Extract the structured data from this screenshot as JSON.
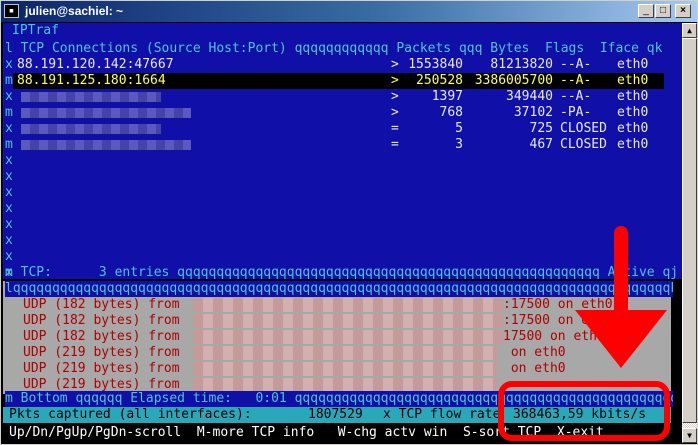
{
  "window": {
    "title": "julien@sachiel: ~",
    "buttons": [
      "_",
      "□",
      "×"
    ]
  },
  "app_name": "IPTraf",
  "tcp": {
    "header": "l TCP Connections (Source Host:Port) qqqqqqqqqqqq Packets qqq Bytes  Flags  Iface qk",
    "rows": [
      {
        "prefix": "x",
        "host": "88.191.120.142:47667",
        "dir": ">",
        "packets": "1553840",
        "bytes": "81213820",
        "flags": "--A-",
        "iface": "eth0",
        "selected": false
      },
      {
        "prefix": "m",
        "host": "88.191.125.180:1664",
        "dir": ">",
        "packets": "250528",
        "bytes": "3386005700",
        "flags": "--A-",
        "iface": "eth0",
        "selected": true
      },
      {
        "prefix": "x",
        "host": "",
        "dir": ">",
        "packets": "1397",
        "bytes": "349440",
        "flags": "--A-",
        "iface": "eth0",
        "selected": false
      },
      {
        "prefix": "m",
        "host": "",
        "dir": ">",
        "packets": "768",
        "bytes": "37102",
        "flags": "-PA-",
        "iface": "eth0",
        "selected": false
      },
      {
        "prefix": "x",
        "host": "",
        "dir": "=",
        "packets": "5",
        "bytes": "725",
        "flags": "CLOSED",
        "iface": "eth0",
        "selected": false
      },
      {
        "prefix": "m",
        "host": "",
        "dir": "=",
        "packets": "3",
        "bytes": "467",
        "flags": "CLOSED",
        "iface": "eth0",
        "selected": false
      }
    ],
    "empty_prefix": "x",
    "footer": "m TCP:      3 entries qqqqqqqqqqqqqqqqqqqqqqqqqqqqqqqqqqqqqqqqqqqqqqqqqqqqqq Active qj"
  },
  "udp": {
    "border_top": "lqqqqqqqqqqqqqqqqqqqqqqqqqqqqqqqqqqqqqqqqqqqqqqqqqqqqqqqqqqqqqqqqqqqqqqqqqqqqqqqqqqqqk",
    "rows": [
      {
        "text": "UDP (182 bytes) from",
        "tail": ":17500 on eth0"
      },
      {
        "text": "UDP (182 bytes) from",
        "tail": ":17500 on eth0"
      },
      {
        "text": "UDP (182 bytes) from",
        "tail": "17500 on eth0"
      },
      {
        "text": "UDP (219 bytes) from",
        "tail": " on eth0"
      },
      {
        "text": "UDP (219 bytes) from",
        "tail": " on eth0"
      },
      {
        "text": "UDP (219 bytes) from",
        "tail": ""
      }
    ],
    "bottom": "m Bottom qqqqqq Elapsed time:   0:01 qqqqqqqqqqqqqqqqqqqqqqqqqqqqqqqqqqqqqqqqqqqqqqqqqqqqqqqj"
  },
  "status": {
    "left": "Pkts captured (all interfaces):",
    "packets": "1807529",
    "mid": "x TCP flow rate",
    "rate": "368463,59 kbits/s"
  },
  "keys": "Up/Dn/PgUp/PgDn-scroll  M-more TCP info   W-chg actv win  S-sort TCP  X-exit"
}
